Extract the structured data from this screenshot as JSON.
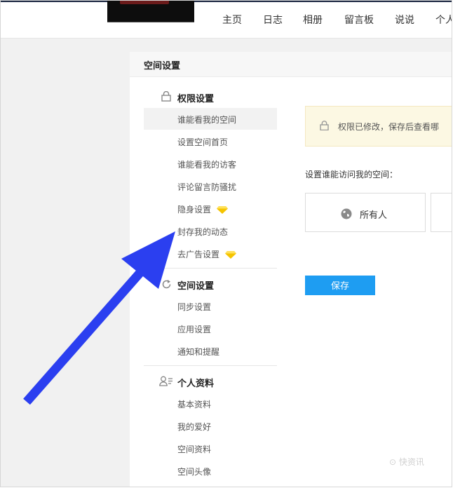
{
  "nav": {
    "items": [
      "主页",
      "日志",
      "相册",
      "留言板",
      "说说",
      "个人"
    ]
  },
  "panel": {
    "title": "空间设置"
  },
  "sidebar": {
    "groups": [
      {
        "title": "权限设置",
        "icon": "lock-icon",
        "items": [
          "谁能看我的空间",
          "设置空间首页",
          "谁能看我的访客",
          "评论留言防骚扰",
          "隐身设置",
          "封存我的动态",
          "去广告设置"
        ]
      },
      {
        "title": "空间设置",
        "icon": "refresh-icon",
        "items": [
          "同步设置",
          "应用设置",
          "通知和提醒"
        ]
      },
      {
        "title": "个人资料",
        "icon": "profile-icon",
        "items": [
          "基本资料",
          "我的爱好",
          "空间资料",
          "空间头像"
        ]
      }
    ]
  },
  "content": {
    "notice": "权限已修改，保存后查看哪",
    "visit_label": "设置谁能访问我的空间：",
    "options": [
      "所有人",
      ""
    ],
    "save_label": "保存"
  },
  "colors": {
    "save": "#1e9df2",
    "notice_bg": "#fcf8e3",
    "arrow": "#2b3ff0",
    "diamond": "#f5c400"
  }
}
